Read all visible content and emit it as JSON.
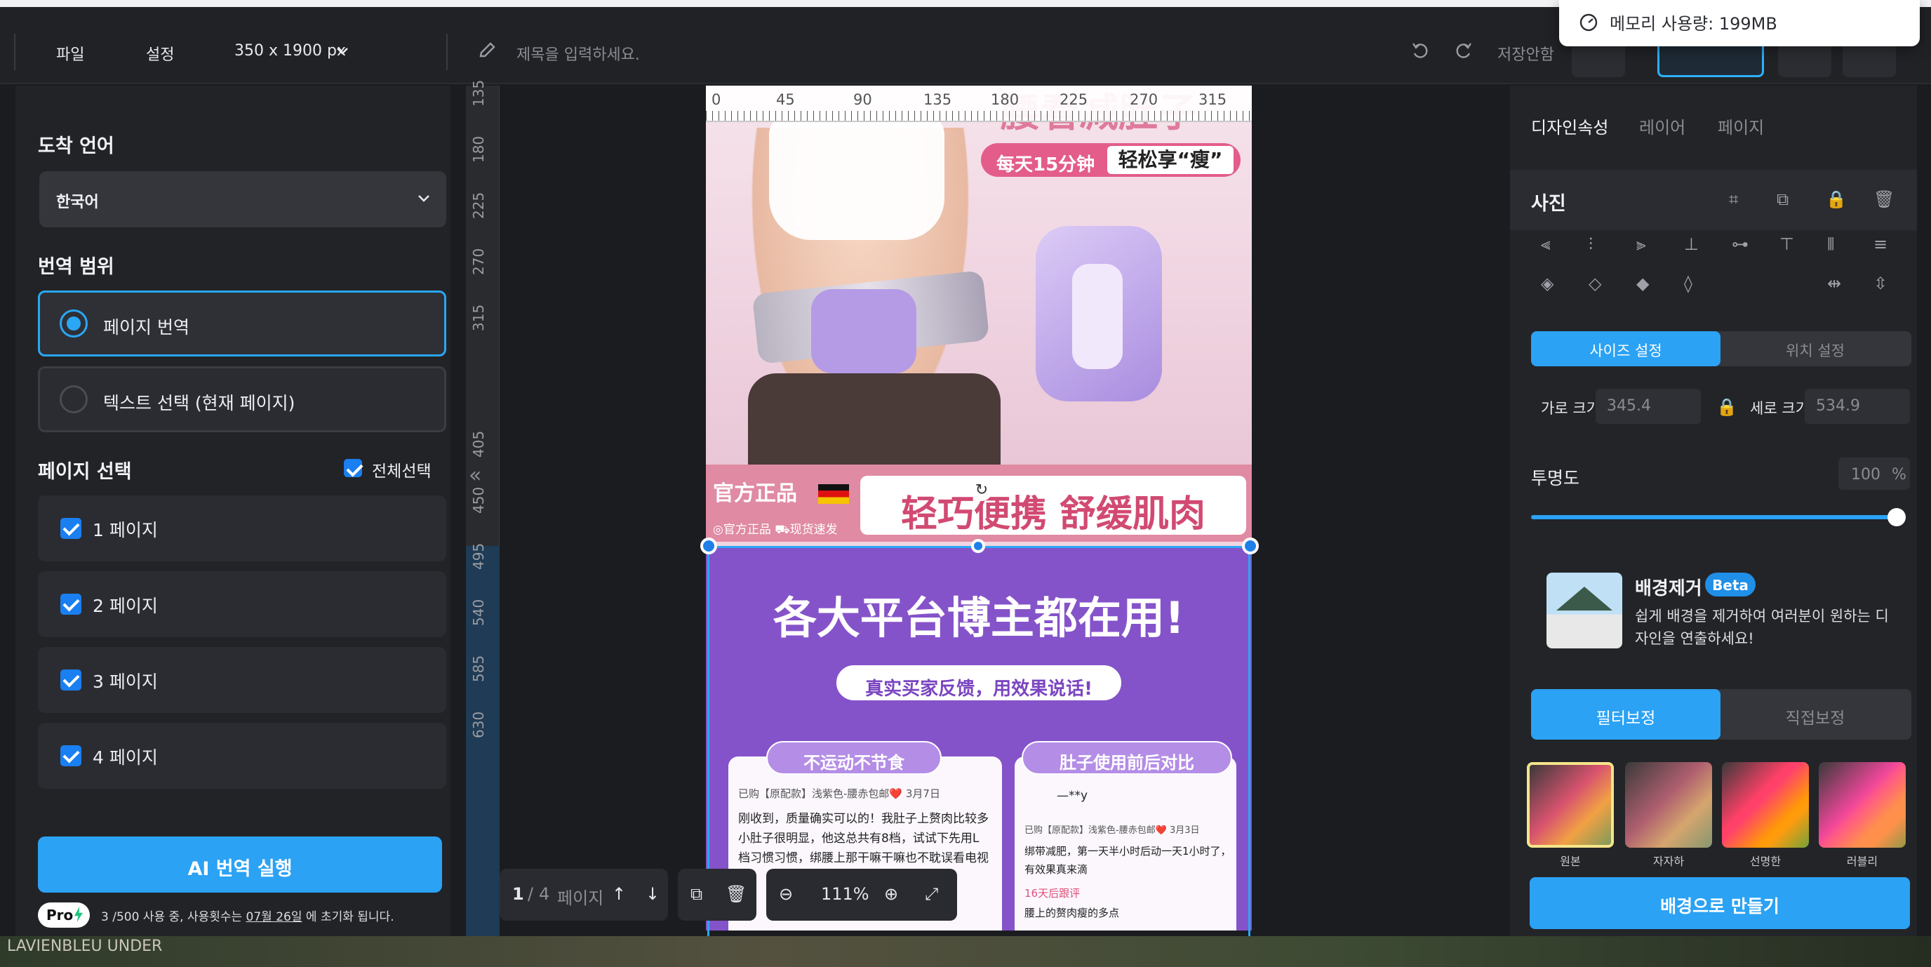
{
  "window": {
    "memory_popup": "메모리 사용량: 199MB"
  },
  "toolbar": {
    "file": "파일",
    "settings": "설정",
    "size": "350 x 1900 px",
    "title_placeholder": "제목을 입력하세요.",
    "save_status": "저장안함"
  },
  "left_panel": {
    "target_lang_label": "도착 언어",
    "target_lang_value": "한국어",
    "scope_label": "번역 범위",
    "scope_options": [
      "페이지 번역",
      "텍스트 선택 (현재 페이지)"
    ],
    "page_select_label": "페이지 선택",
    "select_all": "전체선택",
    "pages": [
      "1 페이지",
      "2 페이지",
      "3 페이지",
      "4 페이지"
    ],
    "ai_button": "AI 번역 실행",
    "pro_badge": "Pro",
    "usage_prefix": "3 /500 사용 중, 사용횟수는 ",
    "usage_date": "07월 26일",
    "usage_suffix": " 에 초기화 됩니다."
  },
  "ruler": {
    "vertical": [
      "135",
      "180",
      "225",
      "270",
      "315",
      "405",
      "450",
      "495",
      "540",
      "585",
      "630"
    ],
    "horizontal": [
      "0",
      "45",
      "90",
      "135",
      "180",
      "225",
      "270",
      "315"
    ]
  },
  "artboard": {
    "top_headline": "腰看减肚子",
    "pill_left": "每天15分钟",
    "pill_right": "轻松享“瘦”",
    "band_tag": "官方正品",
    "band_sub": "◎官方正品 ⛟现货速发",
    "band_big": "轻巧便携 舒缓肌肉",
    "sec2_headline": "各大平台博主都在用!",
    "sec2_sub": "真实买家反馈，用效果说话!",
    "card1_title": "不运动不节食",
    "card1_meta": "已购【原配款】浅紫色-腰赤包邮❤️  3月7日",
    "card1_lines": [
      "刚收到，质量确实可以的！我肚子上赘肉比较多",
      "小肚子很明显，他这总共有8档，试试下先用L",
      "档习惯习惯，绑腰上那干嘛干嘛也不耽误看电视"
    ],
    "card2_title": "肚子使用前后对比",
    "card2_user": "—**y",
    "card2_meta": "已购【原配款】浅紫色-腰赤包邮❤️  3月3日",
    "card2_lines": [
      "绑带减肥，第一天半小时后动一天1小时了，",
      "有效果真来滴"
    ],
    "card2_note": "16天后跟评",
    "card2_last": "腰上的赘肉瘦的多点"
  },
  "canvas_toolbar": {
    "page_current": "1",
    "page_total": "4",
    "page_word": "페이지",
    "zoom": "111%"
  },
  "right_panel": {
    "tabs": [
      "디자인속성",
      "레이어",
      "페이지"
    ],
    "section": "사진",
    "size_tabs": [
      "사이즈 설정",
      "위치 설정"
    ],
    "width_label": "가로 크기",
    "width_value": "345.4",
    "height_label": "세로 크기",
    "height_value": "534.9",
    "opacity_label": "투명도",
    "opacity_value": "100",
    "opacity_unit": "%",
    "opacity_level": 1.0,
    "bg_remove_title": "배경제거",
    "beta": "Beta",
    "bg_remove_desc": "쉽게 배경을 제거하여 여러분이 원하는 디자인을 연출하세요!",
    "filter_tabs": [
      "필터보정",
      "직접보정"
    ],
    "filters": [
      "원본",
      "자자하",
      "선명한",
      "러블리"
    ],
    "make_bg_button": "배경으로 만들기"
  },
  "background_window": {
    "label": "LAVIENBLEU UNDER"
  },
  "colors": {
    "accent": "#2ba2f4",
    "panel": "#232428",
    "selection": "#2aa7f5"
  }
}
